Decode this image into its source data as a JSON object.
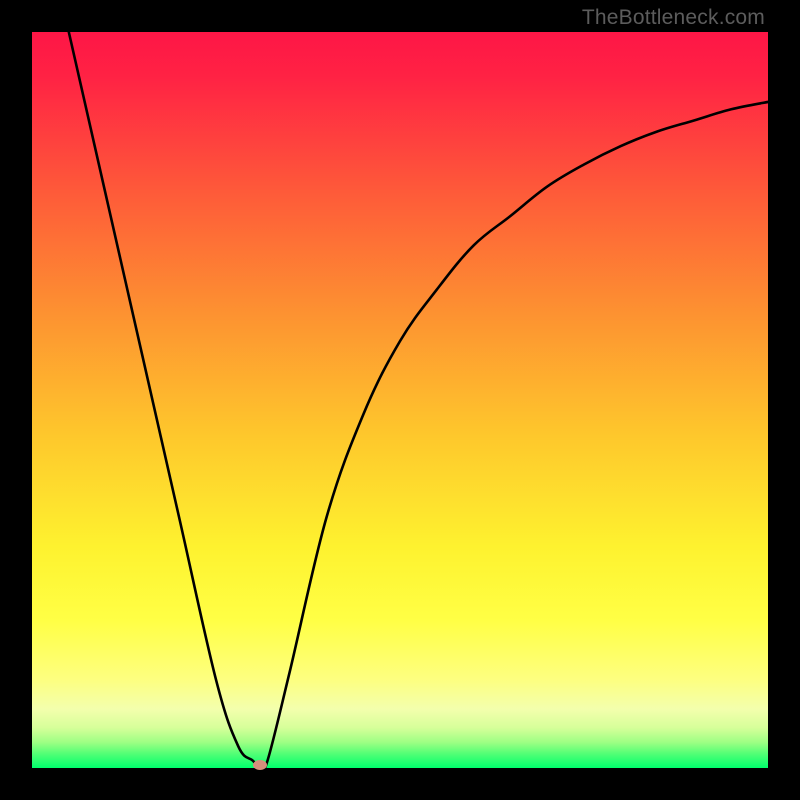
{
  "watermark": "TheBottleneck.com",
  "colors": {
    "top": "#fe1646",
    "mid_upper": "#fd7e34",
    "mid": "#fec82c",
    "mid_lower": "#feff3a",
    "lower_yellow": "#fbff86",
    "near_bottom": "#b8ff7f",
    "bottom": "#00ff6c",
    "curve": "#000000",
    "marker": "#d58f7b",
    "frame": "#000000"
  },
  "chart_data": {
    "type": "line",
    "title": "",
    "xlabel": "",
    "ylabel": "",
    "xlim": [
      0,
      100
    ],
    "ylim": [
      0,
      100
    ],
    "x": [
      5,
      10,
      15,
      20,
      25,
      28,
      30,
      31,
      32,
      35,
      40,
      45,
      50,
      55,
      60,
      65,
      70,
      75,
      80,
      85,
      90,
      95,
      100
    ],
    "values": [
      100,
      78,
      56,
      34,
      12,
      3,
      1,
      0,
      1,
      13,
      34,
      48,
      58,
      65,
      71,
      75,
      79,
      82,
      84.5,
      86.5,
      88,
      89.5,
      90.5
    ],
    "series": [
      {
        "name": "bottleneck-curve",
        "x_ref": "x",
        "y_ref": "values"
      }
    ],
    "marker": {
      "x": 31,
      "y": 0
    },
    "annotations": []
  }
}
